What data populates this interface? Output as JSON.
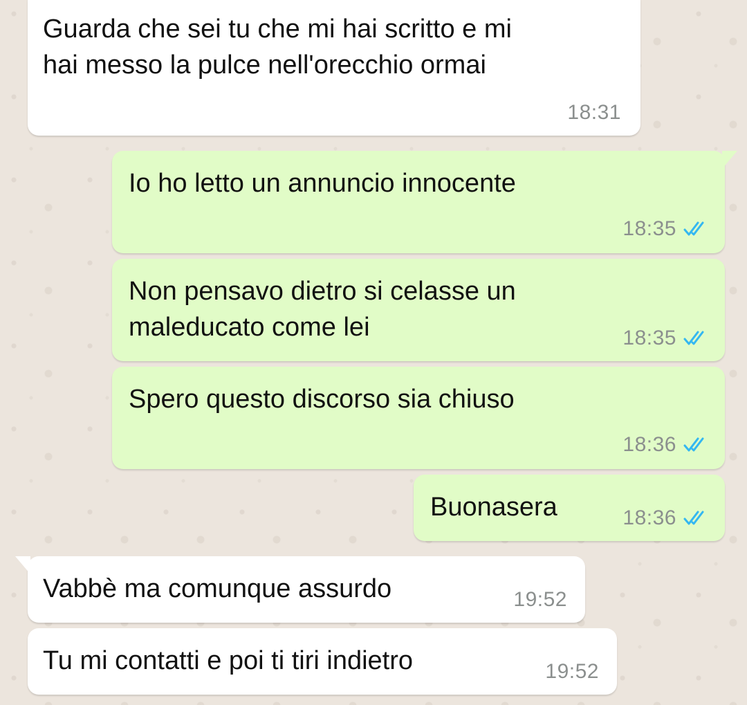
{
  "theme": {
    "background": "#ece5dd",
    "incoming_bubble": "#ffffff",
    "outgoing_bubble": "#e1fcc7",
    "read_tick_color": "#34b7f1",
    "time_color": "#8b8f8e"
  },
  "messages": [
    {
      "direction": "incoming",
      "text": "Guarda che sei tu che mi hai scritto e mi\nhai messo la pulce nell'orecchio ormai",
      "time": "18:31"
    },
    {
      "direction": "outgoing",
      "text": "Io ho letto un annuncio innocente",
      "time": "18:35",
      "status_icon": "double-check-read-icon"
    },
    {
      "direction": "outgoing",
      "text": "Non pensavo dietro si celasse un\nmaleducato come lei",
      "time": "18:35",
      "status_icon": "double-check-read-icon"
    },
    {
      "direction": "outgoing",
      "text": "Spero questo discorso sia chiuso",
      "time": "18:36",
      "status_icon": "double-check-read-icon"
    },
    {
      "direction": "outgoing",
      "text": "Buonasera",
      "time": "18:36",
      "status_icon": "double-check-read-icon"
    },
    {
      "direction": "incoming",
      "text": "Vabbè ma comunque assurdo",
      "time": "19:52"
    },
    {
      "direction": "incoming",
      "text": "Tu mi contatti e poi ti tiri indietro",
      "time": "19:52"
    }
  ]
}
